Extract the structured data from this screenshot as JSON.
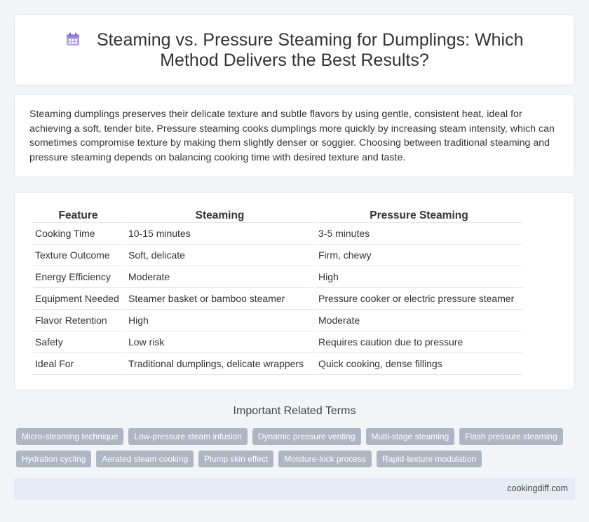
{
  "header": {
    "title": "Steaming vs. Pressure Steaming for Dumplings: Which Method Delivers the Best Results?",
    "icon": "calendar-icon"
  },
  "intro": {
    "text": "Steaming dumplings preserves their delicate texture and subtle flavors by using gentle, consistent heat, ideal for achieving a soft, tender bite. Pressure steaming cooks dumplings more quickly by increasing steam intensity, which can sometimes compromise texture by making them slightly denser or soggier. Choosing between traditional steaming and pressure steaming depends on balancing cooking time with desired texture and taste."
  },
  "table": {
    "headers": [
      "Feature",
      "Steaming",
      "Pressure Steaming"
    ],
    "rows": [
      [
        "Cooking Time",
        "10-15 minutes",
        "3-5 minutes"
      ],
      [
        "Texture Outcome",
        "Soft, delicate",
        "Firm, chewy"
      ],
      [
        "Energy Efficiency",
        "Moderate",
        "High"
      ],
      [
        "Equipment Needed",
        "Steamer basket or bamboo steamer",
        "Pressure cooker or electric pressure steamer"
      ],
      [
        "Flavor Retention",
        "High",
        "Moderate"
      ],
      [
        "Safety",
        "Low risk",
        "Requires caution due to pressure"
      ],
      [
        "Ideal For",
        "Traditional dumplings, delicate wrappers",
        "Quick cooking, dense fillings"
      ]
    ]
  },
  "related": {
    "title": "Important Related Terms",
    "tags_row1": [
      "Micro-steaming technique",
      "Low-pressure steam infusion",
      "Dynamic pressure venting",
      "Multi-stage steaming",
      "Flash pressure steaming"
    ],
    "tags_row2": [
      "Hydration cycling",
      "Aerated steam cooking",
      "Plump skin effect",
      "Moisture-lock process",
      "Rapid-texture modulation"
    ]
  },
  "footer": {
    "site": "cookingdiff.com"
  },
  "colors": {
    "background": "#f3f4f8",
    "tag_bg": "#aeb6c3",
    "footer_bg": "#e6ebf4"
  }
}
